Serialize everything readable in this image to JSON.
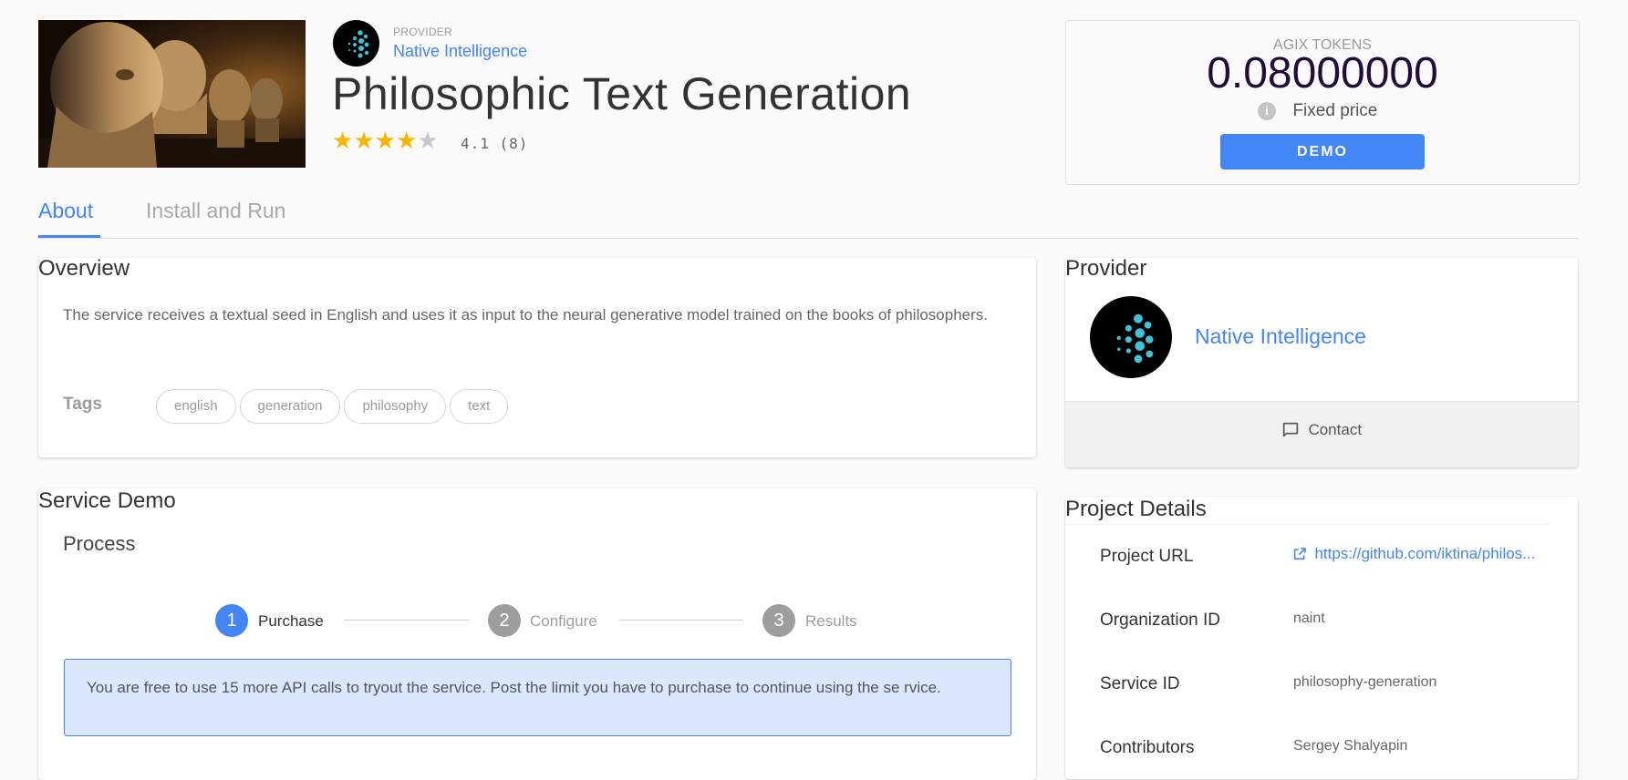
{
  "header": {
    "provider_caption": "PROVIDER",
    "provider_name": "Native Intelligence",
    "service_title": "Philosophic Text Generation",
    "rating_text": "4.1 (8)",
    "rating_value": 4.1,
    "stars_filled": 4,
    "stars_total": 5
  },
  "pricing": {
    "label": "AGIX TOKENS",
    "price": "0.08000000",
    "price_type": "Fixed price",
    "demo_button": "DEMO"
  },
  "tabs": [
    {
      "label": "About",
      "active": true
    },
    {
      "label": "Install and Run",
      "active": false
    }
  ],
  "overview": {
    "title": "Overview",
    "description": "The service receives a textual seed in English and uses it as input to the neural generative model trained on the books of philosophers.",
    "tags_label": "Tags",
    "tags": [
      "english",
      "generation",
      "philosophy",
      "text"
    ]
  },
  "service_demo": {
    "title": "Service Demo",
    "process_title": "Process",
    "steps": [
      {
        "number": "1",
        "label": "Purchase",
        "active": true
      },
      {
        "number": "2",
        "label": "Configure",
        "active": false
      },
      {
        "number": "3",
        "label": "Results",
        "active": false
      }
    ],
    "info_text": "You are free to use 15 more API calls to tryout the service. Post the limit you have to purchase to continue using the se rvice."
  },
  "provider_card": {
    "title": "Provider",
    "name": "Native Intelligence",
    "contact_label": "Contact"
  },
  "project_details": {
    "title": "Project Details",
    "items": [
      {
        "label": "Project URL",
        "value": "https://github.com/iktina/philos..."
      },
      {
        "label": "Organization ID",
        "value": "naint"
      },
      {
        "label": "Service ID",
        "value": "philosophy-generation"
      },
      {
        "label": "Contributors",
        "value": "Sergey Shalyapin"
      }
    ]
  },
  "colors": {
    "accent": "#4285f4",
    "star": "#f7b500",
    "star_empty": "#c8c8c8",
    "logo_dots": "#3fc1d8"
  }
}
